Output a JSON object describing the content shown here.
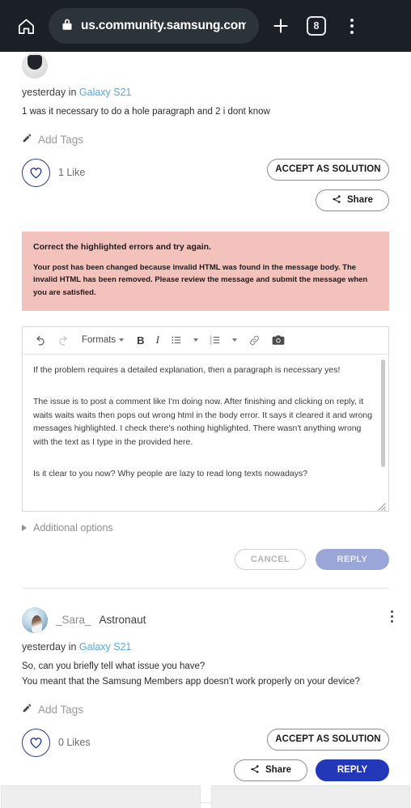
{
  "browser": {
    "home_icon": "home-icon",
    "lock_icon": "lock-icon",
    "url": "us.community.samsung.com/",
    "new_tab_icon": "plus-icon",
    "tab_count": "8",
    "menu_icon": "kebab-menu-icon"
  },
  "post_top": {
    "author": "",
    "rank": "",
    "meta_time": "yesterday in",
    "meta_board": "Galaxy S21",
    "body": "1 was it necessary to do a hole paragraph and 2 i dont know",
    "tags_label": "Add Tags",
    "tags_icon": "pencil-icon",
    "like_icon": "heart-icon",
    "like_label": "1 Like",
    "accept_label": "ACCEPT AS SOLUTION",
    "share_label": "Share",
    "share_icon": "share-icon"
  },
  "error": {
    "line1": "Correct the highlighted errors and try again.",
    "line2": "Your post has been changed because invalid HTML was found in the message body. The invalid HTML has been removed. Please review the message and submit the message when you are satisfied.",
    "background": "#f4c2bc"
  },
  "editor": {
    "toolbar": {
      "undo_icon": "undo-icon",
      "redo_icon": "redo-icon",
      "formats_label": "Formats",
      "bold_label": "B",
      "italic_label": "I",
      "bullet_list_icon": "bullet-list-icon",
      "numbered_list_icon": "numbered-list-icon",
      "link_icon": "link-icon",
      "camera_icon": "camera-icon"
    },
    "paragraphs": [
      "If the problem requires a detailed explanation, then a paragraph is necessary yes!",
      "The issue is to post a comment like I'm doing now. After finishing and clicking on reply, it waits waits waits then pops out wrong html in the body error. It says it cleared it and wrong messages highlighted. I check there's nothing highlighted. There wasn't anything wrong with the text as I type in the provided here.",
      "Is it clear to you now? Why people are lazy to read long texts nowadays?"
    ],
    "scrollbar": "vertical-scrollbar",
    "resize_grip": "resize-grip-icon"
  },
  "additional_options": {
    "label": "Additional options",
    "expand_icon": "triangle-right-icon"
  },
  "form_actions": {
    "cancel_label": "CANCEL",
    "reply_label": "REPLY",
    "reply_color": "#9aa6d8"
  },
  "post_bottom": {
    "author": "_Sara_",
    "rank": "Astronaut",
    "avatar": "user-avatar",
    "menu_icon": "kebab-menu-icon",
    "meta_time": "yesterday in",
    "meta_board": "Galaxy S21",
    "body_line1": "So, can you briefly tell what issue you have?",
    "body_line2": "You meant that the Samsung Members app doesn't work properly on your device?",
    "tags_label": "Add Tags",
    "tags_icon": "pencil-icon",
    "like_icon": "heart-icon",
    "like_label": "0 Likes",
    "accept_label": "ACCEPT AS SOLUTION",
    "share_label": "Share",
    "share_icon": "share-icon",
    "reply_label": "REPLY",
    "reply_color": "#2338b8"
  },
  "theme": {
    "link_color": "#5aa7d6",
    "brand_navy": "#2338b8",
    "chrome_bg": "#1b2026"
  }
}
